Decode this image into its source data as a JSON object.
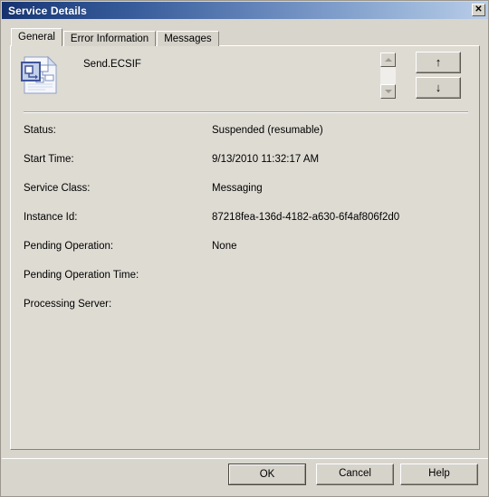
{
  "window": {
    "title": "Service Details",
    "close_label": "✕"
  },
  "tabs": [
    {
      "label": "General",
      "selected": true
    },
    {
      "label": "Error Information",
      "selected": false
    },
    {
      "label": "Messages",
      "selected": false
    }
  ],
  "header": {
    "icon": "orchestration-document-icon",
    "label": "Send.ECSIF"
  },
  "navigation": {
    "scroll_up_icon": "scroll-up-arrow",
    "scroll_down_icon": "scroll-down-arrow",
    "prev_label": "↑",
    "next_label": "↓"
  },
  "fields": [
    {
      "label": "Status:",
      "value": "Suspended (resumable)"
    },
    {
      "label": "Start Time:",
      "value": "9/13/2010 11:32:17 AM"
    },
    {
      "label": "Service Class:",
      "value": "Messaging"
    },
    {
      "label": "Instance Id:",
      "value": "87218fea-136d-4182-a630-6f4af806f2d0"
    },
    {
      "label": "Pending Operation:",
      "value": "None"
    },
    {
      "label": "Pending Operation Time:",
      "value": ""
    },
    {
      "label": "Processing Server:",
      "value": ""
    }
  ],
  "buttons": {
    "ok": "OK",
    "cancel": "Cancel",
    "help": "Help"
  },
  "colors": {
    "title_bar_start": "#16316d",
    "title_bar_end": "#b9cde8",
    "dialog_background": "#d8d5cd",
    "panel_background": "#dedbd3"
  }
}
